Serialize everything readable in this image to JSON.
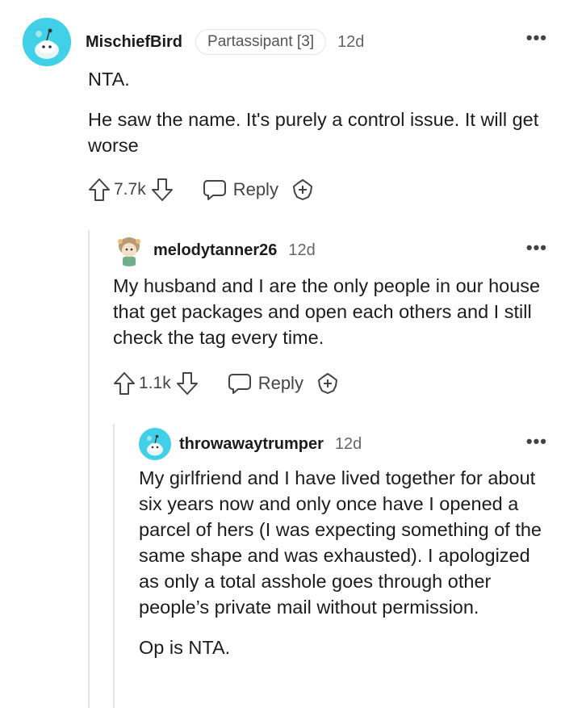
{
  "comments": [
    {
      "username": "MischiefBird",
      "flair": "Partassipant [3]",
      "time": "12d",
      "paragraphs": [
        "NTA.",
        "He saw the name. It's purely a control issue. It will get worse"
      ],
      "votes": "7.7k",
      "reply_label": "Reply"
    },
    {
      "username": "melodytanner26",
      "time": "12d",
      "paragraphs": [
        "My husband and I are the only people in our house that get packages and open each others and I still check the tag every time."
      ],
      "votes": "1.1k",
      "reply_label": "Reply"
    },
    {
      "username": "throwawaytrumper",
      "time": "12d",
      "paragraphs": [
        "My girlfriend and I have lived together for about six years now and only once have I opened a parcel of hers (I was expecting something of the same shape and was exhausted). I apologized as only a total asshole goes through other people’s private mail without permission.",
        "Op is NTA."
      ]
    }
  ],
  "more_label": "•••",
  "colors": {
    "avatar_teal": "#40d0e8",
    "muted": "#666666",
    "thread_line": "#e5e5e5"
  }
}
